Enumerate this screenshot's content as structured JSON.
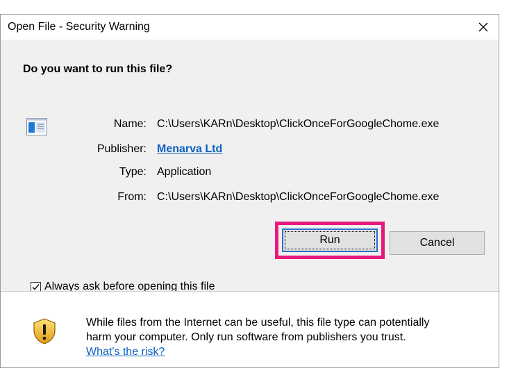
{
  "dialog": {
    "title": "Open File - Security Warning",
    "question": "Do you want to run this file?",
    "name_label": "Name:",
    "name_value": "C:\\Users\\KARn\\Desktop\\ClickOnceForGoogleChome.exe",
    "publisher_label": "Publisher:",
    "publisher_value": "Menarva Ltd",
    "type_label": "Type:",
    "type_value": "Application",
    "from_label": "From:",
    "from_value": "C:\\Users\\KARn\\Desktop\\ClickOnceForGoogleChome.exe",
    "run_label": "Run",
    "cancel_label": "Cancel",
    "checkbox_label": "Always ask before opening this file",
    "checkbox_checked": true,
    "warning_line1": "While files from the Internet can be useful, this file type can potentially",
    "warning_line2": "harm your computer. Only run software from publishers you trust.",
    "risk_link": "What's the risk?"
  },
  "icons": {
    "close": "close-icon",
    "file": "application-file-icon",
    "shield": "warning-shield-icon",
    "check": "checkmark-icon"
  },
  "colors": {
    "link": "#0b5fbf",
    "highlight": "#e8197d",
    "button_focus": "#2a70c8",
    "body_bg": "#f0f0f0"
  }
}
